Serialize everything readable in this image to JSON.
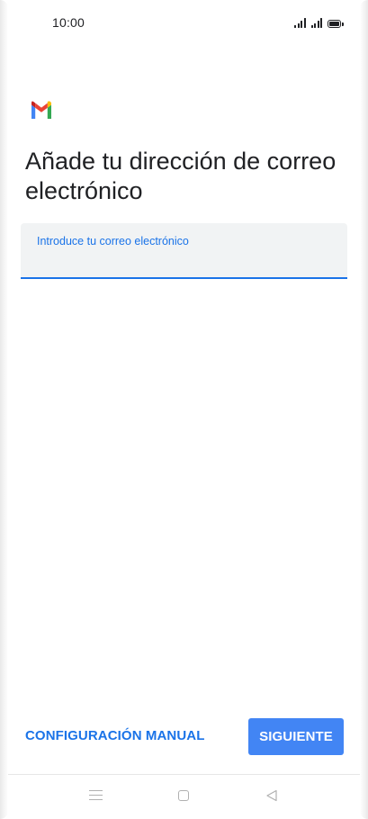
{
  "status_bar": {
    "time": "10:00"
  },
  "icons": {
    "logo": "gmail-logo-icon",
    "signal": "signal-icon",
    "battery": "battery-icon",
    "nav_menu": "menu-icon",
    "nav_home": "home-icon",
    "nav_back": "back-icon"
  },
  "screen": {
    "title": "Añade tu dirección de correo electrónico"
  },
  "email_field": {
    "label": "Introduce tu correo electrónico",
    "value": ""
  },
  "actions": {
    "manual_config_label": "CONFIGURACIÓN MANUAL",
    "next_label": "SIGUIENTE"
  },
  "colors": {
    "accent": "#1a73e8",
    "primary_button": "#4285f4",
    "field_background": "#f1f3f4",
    "text": "#202124"
  }
}
